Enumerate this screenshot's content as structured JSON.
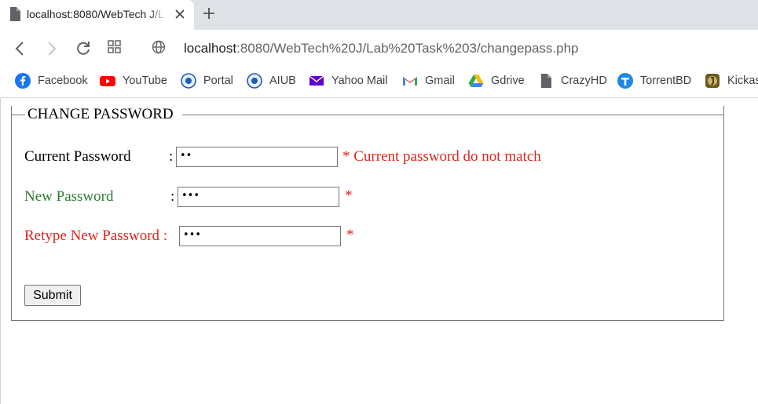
{
  "browser": {
    "tab_title": "localhost:8080/WebTech J/L",
    "url_host": "localhost",
    "url_rest": ":8080/WebTech%20J/Lab%20Task%203/changepass.php"
  },
  "bookmarks": [
    {
      "label": "Facebook",
      "icon": "facebook-icon",
      "color": "#1877f2"
    },
    {
      "label": "YouTube",
      "icon": "youtube-icon",
      "color": "#ff0000"
    },
    {
      "label": "Portal",
      "icon": "portal-icon",
      "color": "#1e5bb8"
    },
    {
      "label": "AIUB",
      "icon": "aiub-icon",
      "color": "#1e5bb8"
    },
    {
      "label": "Yahoo Mail",
      "icon": "yahoo-mail-icon",
      "color": "#6001d2"
    },
    {
      "label": "Gmail",
      "icon": "gmail-icon",
      "color": "#ea4335"
    },
    {
      "label": "Gdrive",
      "icon": "gdrive-icon",
      "color": "#34a853"
    },
    {
      "label": "CrazyHD",
      "icon": "document-icon",
      "color": "#5f6368"
    },
    {
      "label": "TorrentBD",
      "icon": "torrentbd-icon",
      "color": "#1e88e5"
    },
    {
      "label": "Kickass",
      "icon": "kickass-icon",
      "color": "#6b5a1e"
    }
  ],
  "form": {
    "legend": "CHANGE PASSWORD",
    "current_password": {
      "label": "Current Password",
      "colon": ":",
      "value": "••",
      "error": "* Current password do not match",
      "label_color": "#000000"
    },
    "new_password": {
      "label": "New Password",
      "colon": ":",
      "value": "•••",
      "error": "*",
      "label_color": "#2e7d32"
    },
    "retype_password": {
      "label": "Retype New Password :",
      "value": "•••",
      "error": "*",
      "label_color": "#e0251d"
    },
    "submit_label": "Submit"
  }
}
